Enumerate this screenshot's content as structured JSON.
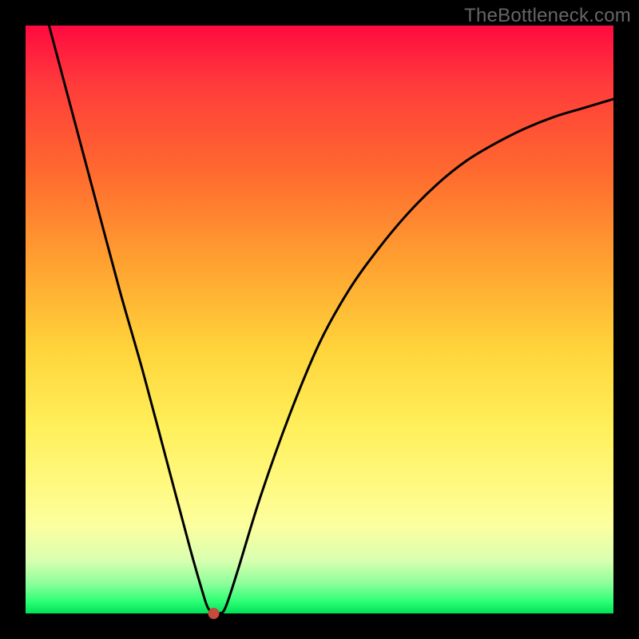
{
  "watermark": "TheBottleneck.com",
  "chart_data": {
    "type": "line",
    "title": "",
    "xlabel": "",
    "ylabel": "",
    "xlim": [
      0,
      100
    ],
    "ylim": [
      0,
      100
    ],
    "grid": false,
    "legend": false,
    "background": "vertical-gradient-red-to-green",
    "series": [
      {
        "name": "bottleneck-curve",
        "x": [
          4,
          8,
          12,
          16,
          20,
          24,
          28,
          30,
          31,
          32,
          33,
          34,
          36,
          40,
          45,
          50,
          55,
          60,
          65,
          70,
          75,
          80,
          85,
          90,
          95,
          100
        ],
        "y": [
          100,
          85,
          70,
          55,
          41,
          26,
          11,
          4,
          1,
          0,
          0,
          1,
          7,
          20,
          34,
          46,
          55,
          62,
          68,
          73,
          77,
          80,
          82.5,
          84.5,
          86,
          87.5
        ]
      }
    ],
    "marker": {
      "x": 32,
      "y": 0,
      "color": "#c44b3e"
    }
  }
}
